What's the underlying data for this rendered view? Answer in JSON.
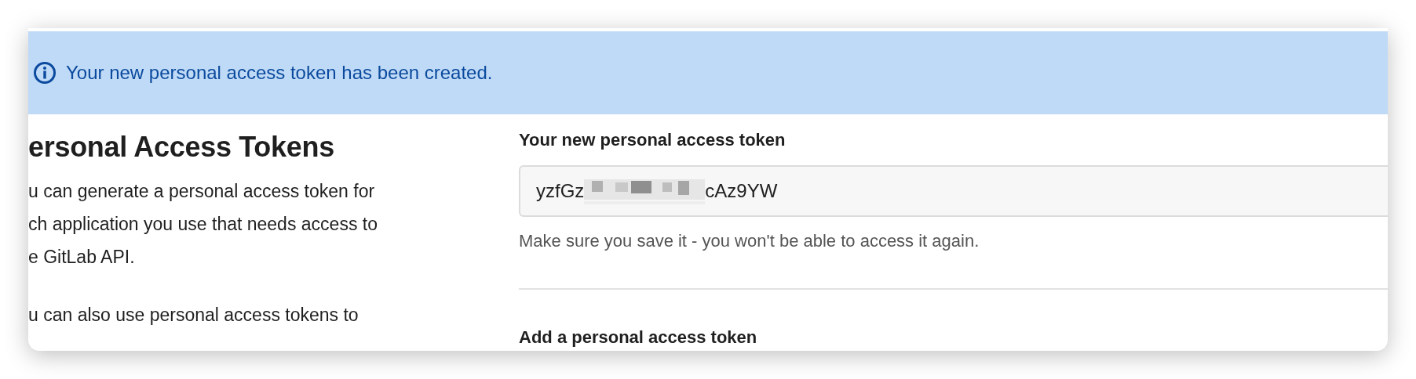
{
  "alert": {
    "text": "Your new personal access token has been created."
  },
  "intro": {
    "heading": "ersonal Access Tokens",
    "lines": [
      "u can generate a personal access token for",
      "ch application you use that needs access to",
      "e GitLab API."
    ],
    "lines_2": [
      "u can also use personal access tokens to"
    ]
  },
  "new_token": {
    "label": "Your new personal access token",
    "value_start": "yzfGz",
    "value_end": "cAz9YW",
    "help": "Make sure you save it - you won't be able to access it again."
  },
  "add_section": {
    "heading": "Add a personal access token"
  }
}
